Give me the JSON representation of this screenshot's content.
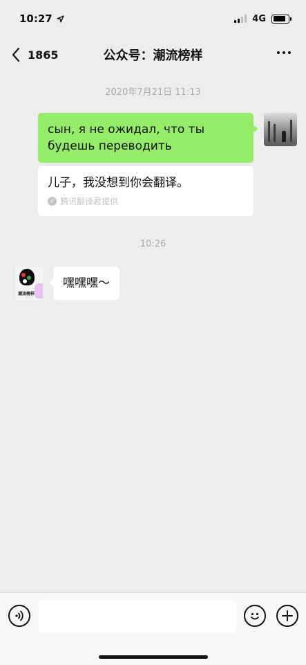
{
  "status_bar": {
    "time": "10:27",
    "network": "4G",
    "battery_level": 0.85
  },
  "nav": {
    "back_count": "1865",
    "title": "公众号：潮流榜样"
  },
  "chat": {
    "timestamp_1": "2020年7月21日 11:13",
    "sent_message": "сын, я не ожидал, что ты будешь переводить",
    "translation": "儿子，我没想到你会翻译。",
    "translation_source": "腾讯翻译君提供",
    "timestamp_2": "10:26",
    "received_message": "嘿嘿嘿～",
    "avatar_brand": "潮流榜样"
  },
  "input_bar": {
    "placeholder": ""
  },
  "icons": [
    "location-arrow-icon",
    "signal-icon",
    "battery-icon",
    "back-chevron-icon",
    "more-icon",
    "check-icon",
    "voice-icon",
    "emoji-icon",
    "plus-icon"
  ]
}
